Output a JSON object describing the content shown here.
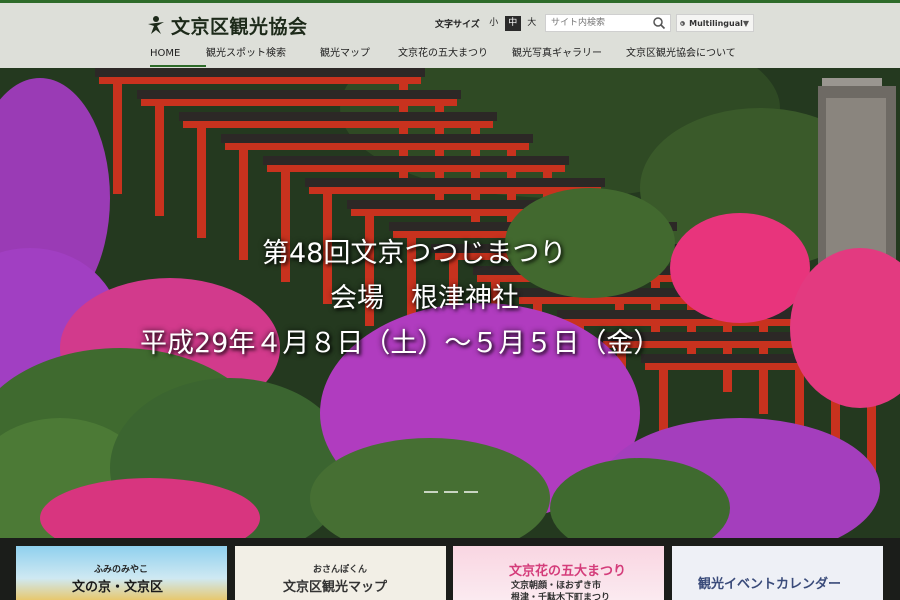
{
  "site": {
    "logo_text": "文京区観光協会",
    "logo_icon": "person-logo-icon"
  },
  "header": {
    "font_size_label": "文字サイズ",
    "font_sizes": [
      "小",
      "中",
      "大"
    ],
    "font_size_selected": "中",
    "search_placeholder": "サイト内検索",
    "language_label": "Multilingual"
  },
  "nav": {
    "items": [
      {
        "label": "HOME",
        "active": true
      },
      {
        "label": "観光スポット検索"
      },
      {
        "label": "観光マップ"
      },
      {
        "label": "文京花の五大まつり"
      },
      {
        "label": "観光写真ギャラリー"
      },
      {
        "label": "文京区観光協会について"
      }
    ]
  },
  "hero": {
    "line1": "第48回文京つつじまつり",
    "line2": "会場　根津神社",
    "line3": "平成29年４月８日（土）～５月５日（金）",
    "slide_count": 3
  },
  "banners": [
    {
      "sub": "ふみのみやこ",
      "main": "文の京・文京区"
    },
    {
      "sub": "おさんぽくん",
      "main": "文京区観光マップ"
    },
    {
      "sub": "文京朝顔・ほおずき市",
      "main": "文京花の五大まつり",
      "extra": "根津・千駄木下町まつり"
    },
    {
      "sub": "",
      "main": "観光イベントカレンダー"
    }
  ],
  "colors": {
    "brand_green": "#2e6b2a",
    "torii_red": "#c8321e",
    "azalea_pink": "#e0307a",
    "azalea_purple": "#b23ec2"
  }
}
